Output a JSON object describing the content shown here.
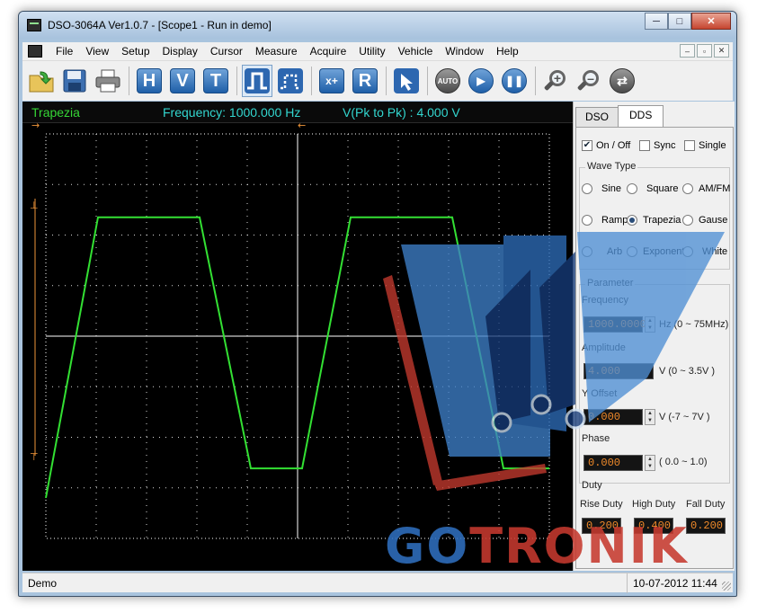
{
  "window": {
    "title": "DSO-3064A Ver1.0.7 - [Scope1 - Run in demo]",
    "controls": [
      "─",
      "□",
      "✕"
    ]
  },
  "menu": {
    "items": [
      "File",
      "View",
      "Setup",
      "Display",
      "Cursor",
      "Measure",
      "Acquire",
      "Utility",
      "Vehicle",
      "Window",
      "Help"
    ],
    "mdi_controls": [
      "–",
      "▫",
      "✕"
    ]
  },
  "toolbar": {
    "h_label": "H",
    "v_label": "V",
    "t_label": "T",
    "r_label": "R",
    "auto_label": "AUTO",
    "math_label": "x+"
  },
  "scope": {
    "wave_name": "Trapezia",
    "frequency_readout": "Frequency: 1000.000 Hz",
    "vpp_readout": "V(Pk to Pk) : 4.000 V",
    "colors": {
      "grid": "#ffffff",
      "trace": "#33e033",
      "marker": "#f0963a"
    }
  },
  "dds": {
    "tabs": [
      "DSO",
      "DDS"
    ],
    "active_tab": "DDS",
    "on_off_label": "On / Off",
    "on_off_checked": true,
    "sync_label": "Sync",
    "single_label": "Single",
    "wave_type_title": "Wave Type",
    "wave_types": [
      "Sine",
      "Square",
      "AM/FM",
      "Ramp",
      "Trapezia",
      "Gause",
      "Arb",
      "Exponent",
      "White"
    ],
    "selected_wave": "Trapezia",
    "parameter_title": "Parameter",
    "frequency_label": "Frequency",
    "frequency_value": "1000.0000",
    "frequency_range": "Hz (0 ~ 75MHz)",
    "amplitude_label": "Amplitude",
    "amplitude_value": "4.000",
    "amplitude_range": "V    (0 ~ 3.5V )",
    "offset_label": "Y Offset",
    "offset_value": "0.000",
    "offset_range": "V   (-7  ~ 7V )",
    "phase_label": "Phase",
    "phase_value": "0.000",
    "phase_range": "( 0.0 ~ 1.0)",
    "duty_title": "Duty",
    "rise_label": "Rise Duty",
    "rise_value": "0.200",
    "high_label": "High Duty",
    "high_value": "0.400",
    "fall_label": "Fall Duty",
    "fall_value": "0.200"
  },
  "status": {
    "mode": "Demo",
    "datetime": "10-07-2012  11:44"
  },
  "watermark": {
    "text_part1": "GO",
    "text_part2": "TRONIK"
  }
}
